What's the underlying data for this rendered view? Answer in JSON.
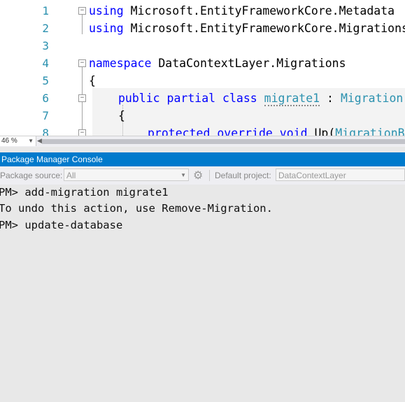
{
  "editor": {
    "line_numbers": [
      "1",
      "2",
      "3",
      "4",
      "5",
      "6",
      "7",
      "8"
    ],
    "lines": {
      "l1": {
        "kw": "using",
        "rest": " Microsoft.EntityFrameworkCore.Metadata"
      },
      "l2": {
        "kw": "using",
        "rest": " Microsoft.EntityFrameworkCore.Migrations"
      },
      "l4": {
        "kw": "namespace",
        "rest": " DataContextLayer.Migrations"
      },
      "l5": {
        "text": "{"
      },
      "l6": {
        "kw1": "public",
        "kw2": "partial",
        "kw3": "class",
        "name": "migrate1",
        "sep": " : ",
        "base": "Migration"
      },
      "l7": {
        "text": "{"
      },
      "l8": {
        "kw1": "protected",
        "kw2": "override",
        "kw3": "void",
        "rest": " Up(",
        "type": "MigrationBuilder"
      }
    }
  },
  "statusbar": {
    "zoom": "46 %"
  },
  "pmc": {
    "title": "Package Manager Console",
    "package_source_label": "Package source:",
    "package_source_value": "All",
    "default_project_label": "Default project:",
    "default_project_value": "DataContextLayer",
    "console_lines": [
      "PM> add-migration migrate1",
      "To undo this action, use Remove-Migration.",
      "PM> update-database"
    ]
  }
}
